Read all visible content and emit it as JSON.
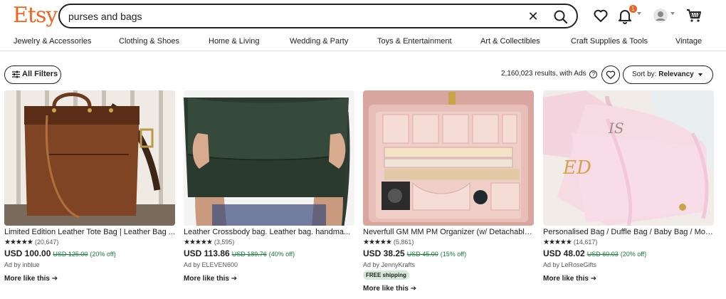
{
  "header": {
    "logo": "Etsy",
    "search_value": "purses and bags",
    "notification_count": "1"
  },
  "categories": [
    "Jewelry & Accessories",
    "Clothing & Shoes",
    "Home & Living",
    "Wedding & Party",
    "Toys & Entertainment",
    "Art & Collectibles",
    "Craft Supplies & Tools",
    "Vintage"
  ],
  "toolbar": {
    "filters_label": "All Filters",
    "results_text": "2,160,023 results, with Ads",
    "help_glyph": "?",
    "sort_prefix": "Sort by: ",
    "sort_value": "Relevancy"
  },
  "listings": [
    {
      "title": "Limited Edition Leather Tote Bag | Leather Bag ...",
      "stars": "★★★★★",
      "reviews": "(20,647)",
      "price": "USD 100.00",
      "original_price": "USD 125.00",
      "discount": "(20% off)",
      "ad_by": "Ad by inblue",
      "badge": "",
      "more": "More like this"
    },
    {
      "title": "Leather Crossbody bag. Leather bag. handma...",
      "stars": "★★★★★",
      "reviews": "(3,595)",
      "price": "USD 113.86",
      "original_price": "USD 189.76",
      "discount": "(40% off)",
      "ad_by": "Ad by ELEVEN600",
      "badge": "",
      "more": "More like this"
    },
    {
      "title": "Neverfull GM MM PM Organizer (w/ Detachable...",
      "stars": "★★★★★",
      "reviews": "(5,861)",
      "price": "USD 38.25",
      "original_price": "USD 45.00",
      "discount": "(15% off)",
      "ad_by": "Ad by JennyKrafts",
      "badge": "FREE shipping",
      "more": "More like this"
    },
    {
      "title": "Personalised Bag / Duffle Bag / Baby Bag / Mon...",
      "stars": "★★★★★",
      "reviews": "(14,617)",
      "price": "USD 48.02",
      "original_price": "USD 60.03",
      "discount": "(20% off)",
      "ad_by": "Ad by LeRoseGifts",
      "badge": "",
      "more": "More like this"
    }
  ],
  "colors": {
    "brand": "#F1641E",
    "discount": "#1c7a3f",
    "shipping_badge": "#d4e9d7"
  }
}
